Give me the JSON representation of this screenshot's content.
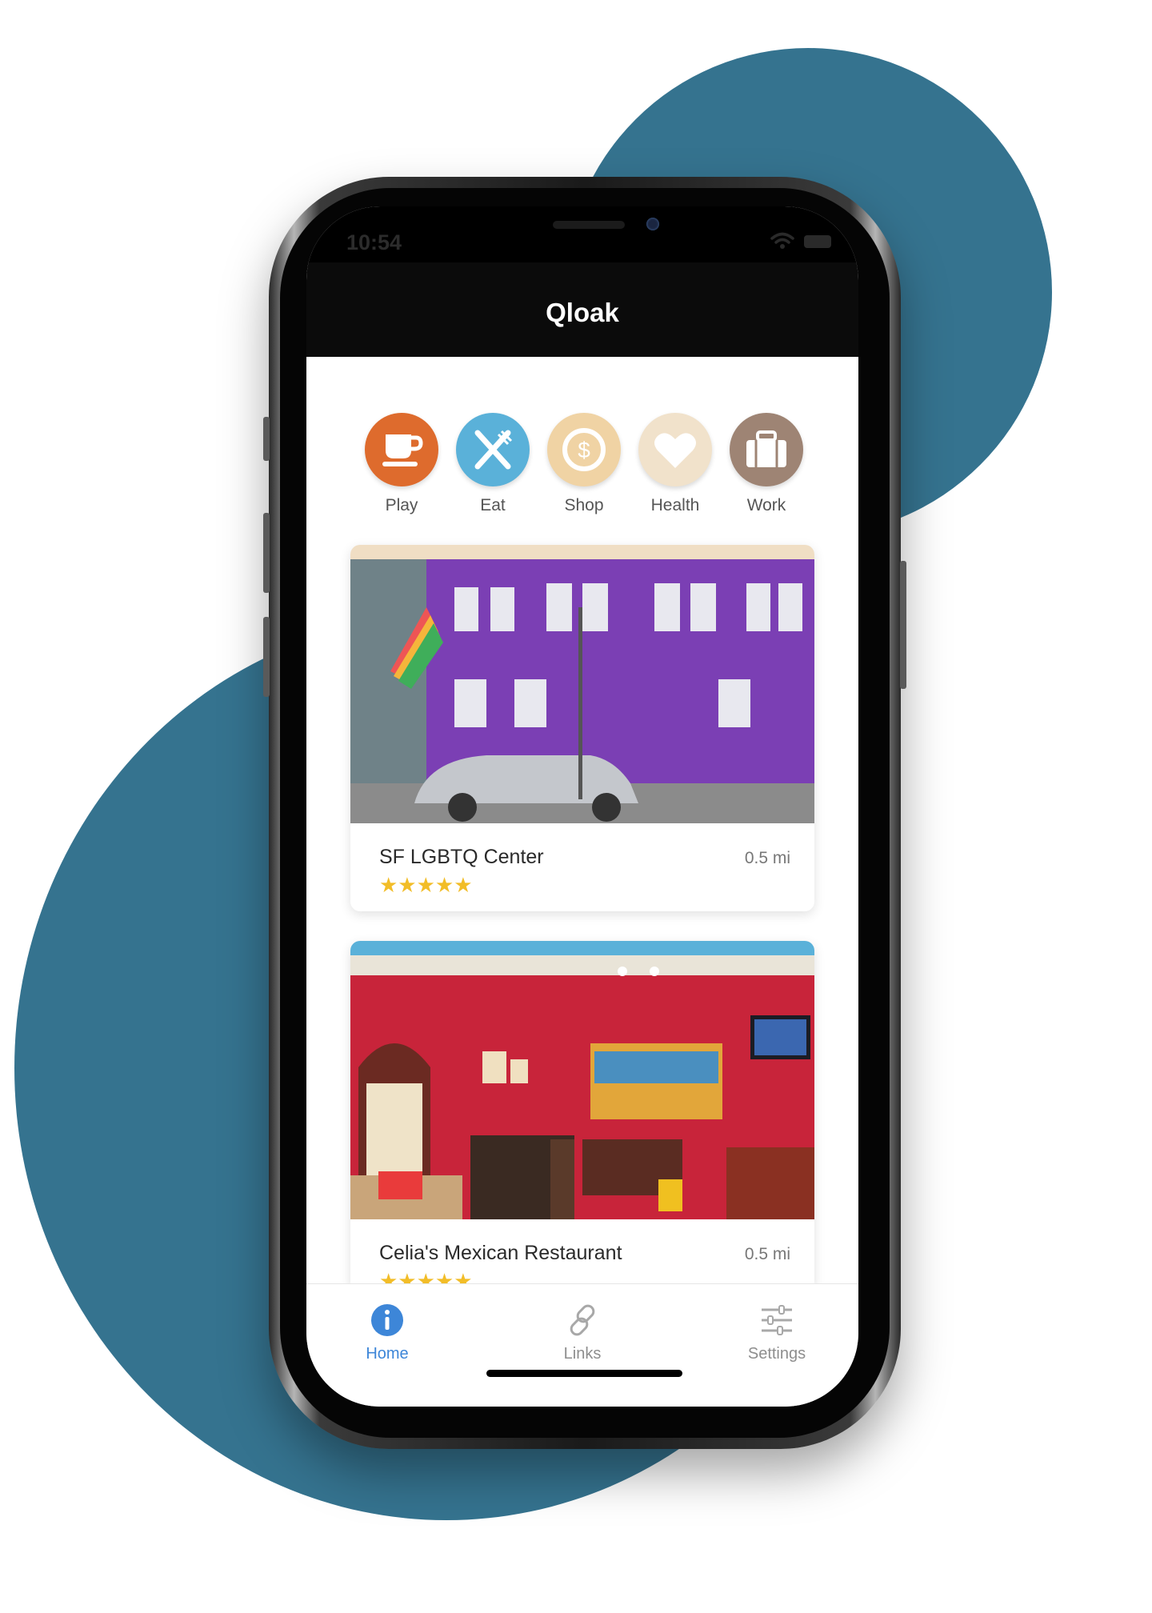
{
  "colors": {
    "accent": "#3d86d8",
    "blob": "#35738f",
    "star": "#f2bd28",
    "play": "#de6b2d",
    "eat": "#5ab1d9",
    "shop": "#f0d3a4",
    "health": "#f1e2cb",
    "work": "#9e8474"
  },
  "status_bar": {
    "time": "10:54",
    "icons": [
      "wifi-icon",
      "battery-icon"
    ]
  },
  "header": {
    "title": "Qloak"
  },
  "categories": [
    {
      "label": "Play",
      "icon": "coffee-cup-icon"
    },
    {
      "label": "Eat",
      "icon": "fork-knife-icon"
    },
    {
      "label": "Shop",
      "icon": "dollar-coin-icon"
    },
    {
      "label": "Health",
      "icon": "heart-icon"
    },
    {
      "label": "Work",
      "icon": "briefcase-icon"
    }
  ],
  "places": [
    {
      "name": "SF LGBTQ Center",
      "distance": "0.5 mi",
      "stars": "★★★★★",
      "rating": 5
    },
    {
      "name": "Celia's Mexican Restaurant",
      "distance": "0.5 mi",
      "stars": "★★★★★",
      "rating": 5
    }
  ],
  "tabs": [
    {
      "label": "Home",
      "icon": "info-icon",
      "active": true
    },
    {
      "label": "Links",
      "icon": "link-icon",
      "active": false
    },
    {
      "label": "Settings",
      "icon": "sliders-icon",
      "active": false
    }
  ]
}
